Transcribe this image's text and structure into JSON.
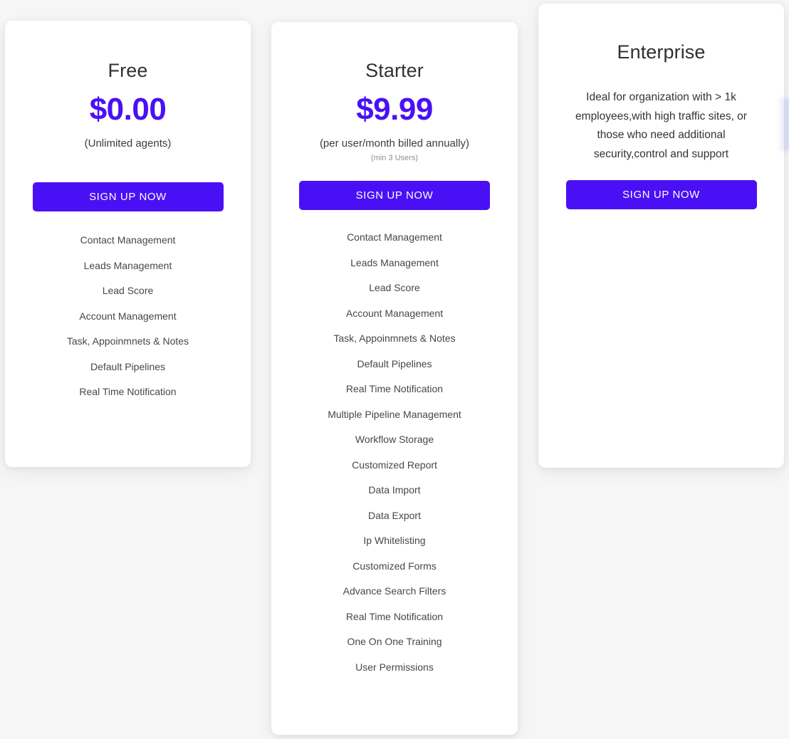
{
  "page": {
    "background_color": "#f6f6f7",
    "accent_color": "#4a10f5"
  },
  "plans": [
    {
      "id": "free",
      "title": "Free",
      "price": "$0.00",
      "note": "(Unlimited agents)",
      "subnote": "",
      "description": "",
      "cta_label": "SIGN UP NOW",
      "features": [
        "Contact Management",
        "Leads Management",
        "Lead Score",
        "Account Management",
        "Task, Appoinmnets & Notes",
        "Default Pipelines",
        "Real Time Notification"
      ]
    },
    {
      "id": "starter",
      "title": "Starter",
      "price": "$9.99",
      "note": "(per user/month billed annually)",
      "subnote": "(min 3 Users)",
      "description": "",
      "cta_label": "SIGN UP NOW",
      "features": [
        "Contact Management",
        "Leads Management",
        "Lead Score",
        "Account Management",
        "Task, Appoinmnets & Notes",
        "Default Pipelines",
        "Real Time Notification",
        "Multiple Pipeline Management",
        "Workflow Storage",
        "Customized Report",
        "Data Import",
        "Data Export",
        "Ip Whitelisting",
        "Customized Forms",
        "Advance Search Filters",
        "Real Time Notification",
        "One On One Training",
        "User Permissions"
      ]
    },
    {
      "id": "enterprise",
      "title": "Enterprise",
      "price": "",
      "note": "",
      "subnote": "",
      "description": "Ideal for organization with > 1k employees,with high traffic sites, or those who need additional security,control and support",
      "cta_label": "SIGN UP NOW",
      "features": []
    }
  ]
}
